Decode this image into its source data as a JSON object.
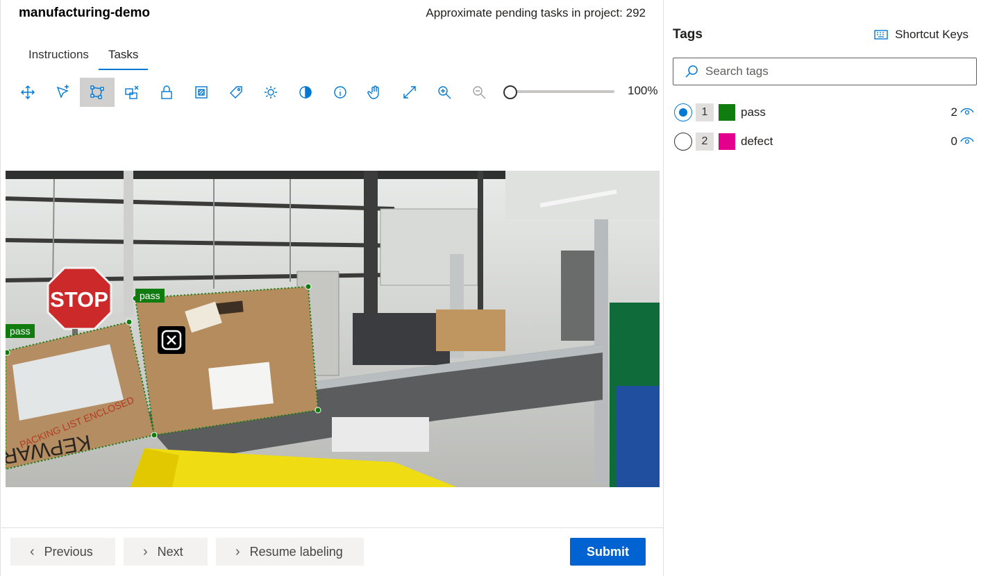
{
  "header": {
    "project_title": "manufacturing-demo",
    "pending_tasks": "Approximate pending tasks in project: 292"
  },
  "tabs": [
    {
      "label": "Instructions",
      "active": false
    },
    {
      "label": "Tasks",
      "active": true
    }
  ],
  "toolbar": {
    "tools": [
      "move-icon",
      "add-point-icon",
      "polygon-icon",
      "region-icon",
      "lock-icon",
      "crop-icon",
      "tag-icon",
      "brightness-icon",
      "contrast-icon",
      "info-icon",
      "pan-hand-icon",
      "fit-icon",
      "zoom-in-icon",
      "zoom-out-icon"
    ],
    "active_tool": "polygon-icon",
    "zoom_value": "100%",
    "zoom_level": 0
  },
  "annotations": [
    {
      "label": "pass"
    },
    {
      "label": "pass"
    }
  ],
  "footer": {
    "previous_label": "Previous",
    "next_label": "Next",
    "resume_label": "Resume labeling",
    "submit_label": "Submit"
  },
  "sidebar": {
    "title": "Tags",
    "shortcut_label": "Shortcut Keys",
    "search_placeholder": "Search tags",
    "tags": [
      {
        "num": "1",
        "name": "pass",
        "count": "2",
        "color": "#107c10",
        "selected": true
      },
      {
        "num": "2",
        "name": "defect",
        "count": "0",
        "color": "#e3008c",
        "selected": false
      }
    ]
  },
  "colors": {
    "accent": "#0078d4",
    "submit": "#0063d1",
    "pass": "#107c10",
    "defect": "#e3008c"
  }
}
